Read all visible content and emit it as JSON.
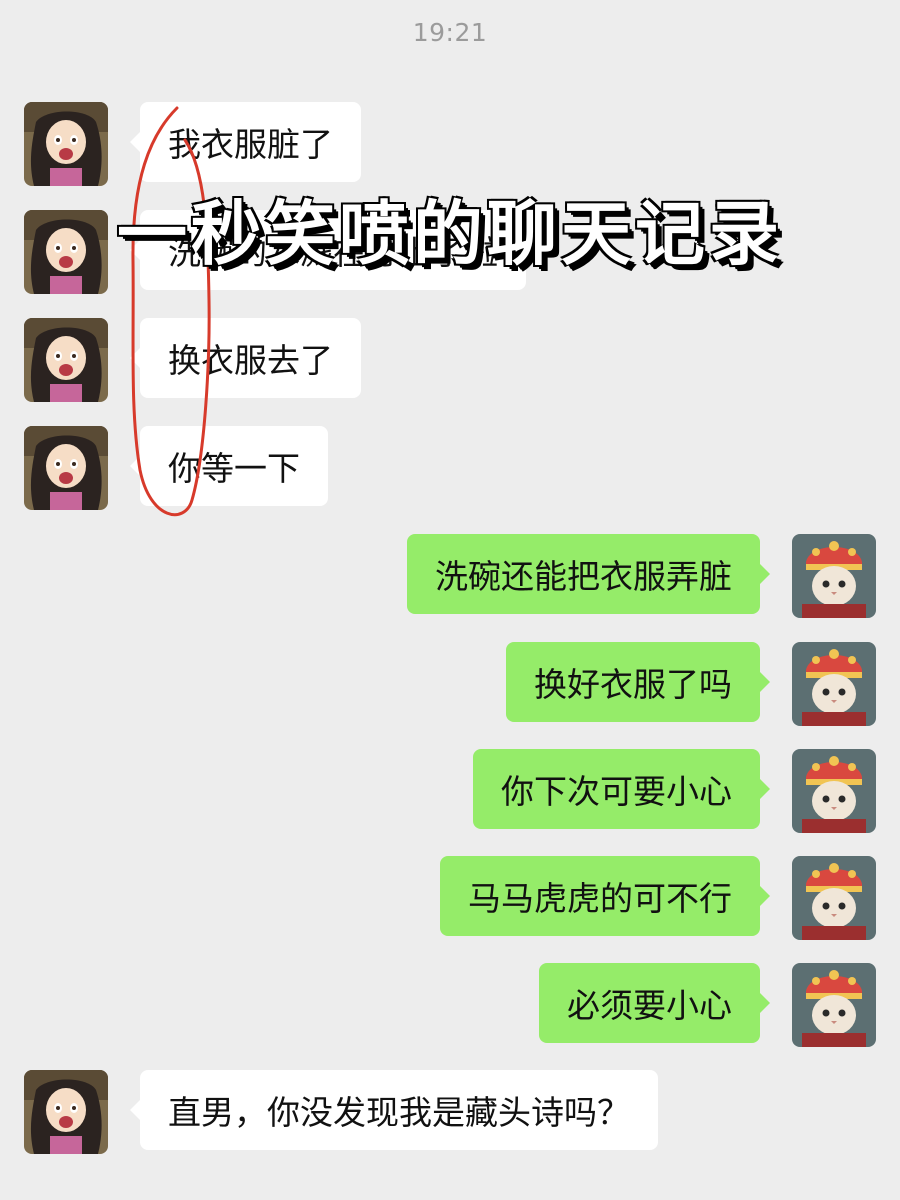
{
  "status": {
    "time": "19:21"
  },
  "overlay": {
    "title": "一秒笑喷的聊天记录"
  },
  "messages": [
    {
      "side": "left",
      "text": "我衣服脏了"
    },
    {
      "side": "left",
      "text": "洗碗的水溅在身上了啦"
    },
    {
      "side": "left",
      "text": "换衣服去了"
    },
    {
      "side": "left",
      "text": "你等一下"
    },
    {
      "side": "right",
      "text": "洗碗还能把衣服弄脏"
    },
    {
      "side": "right",
      "text": "换好衣服了吗"
    },
    {
      "side": "right",
      "text": "你下次可要小心"
    },
    {
      "side": "right",
      "text": "马马虎虎的可不行"
    },
    {
      "side": "right",
      "text": "必须要小心"
    },
    {
      "side": "left",
      "text": "直男，你没发现我是藏头诗吗？"
    }
  ],
  "avatars": {
    "left": {
      "icon": "anime-girl-avatar"
    },
    "right": {
      "icon": "cat-headdress-avatar"
    }
  },
  "colors": {
    "background": "#ededed",
    "incoming_bubble": "#ffffff",
    "outgoing_bubble": "#95ec69",
    "annotation": "#d73a2b"
  }
}
